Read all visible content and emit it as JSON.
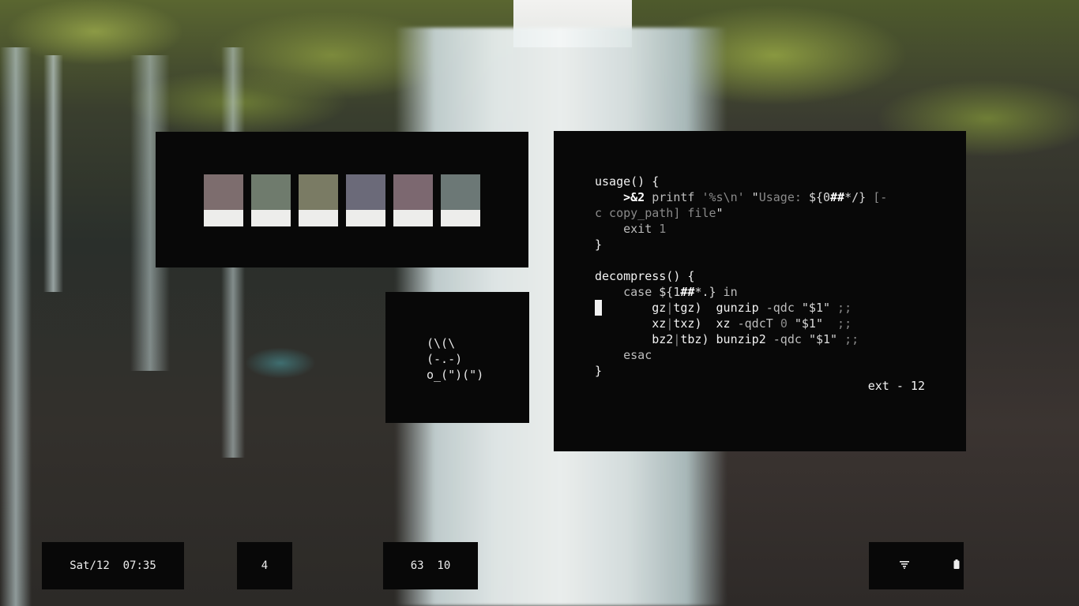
{
  "palette": {
    "swatches": [
      {
        "top": "#7d6d6e",
        "bottom": "#ededeb"
      },
      {
        "top": "#6f7b6d",
        "bottom": "#ededeb"
      },
      {
        "top": "#7a7b64",
        "bottom": "#ededeb"
      },
      {
        "top": "#6b6a79",
        "bottom": "#ededeb"
      },
      {
        "top": "#7c6870",
        "bottom": "#ededeb"
      },
      {
        "top": "#6c7876",
        "bottom": "#ededeb"
      }
    ]
  },
  "ascii_art": [
    "(\\(\\",
    "(-.-)",
    "o_(\")(\")"
  ],
  "editor": {
    "lines": [
      [
        {
          "t": "usage() {",
          "c": "kw-fn"
        }
      ],
      [
        {
          "t": "    ",
          "c": ""
        },
        {
          "t": ">&2",
          "c": "kw-bold"
        },
        {
          "t": " printf ",
          "c": ""
        },
        {
          "t": "'%s\\n'",
          "c": "dim"
        },
        {
          "t": " \"",
          "c": "str"
        },
        {
          "t": "Usage: ",
          "c": "dim"
        },
        {
          "t": "${0",
          "c": "str"
        },
        {
          "t": "##",
          "c": "kw-bold"
        },
        {
          "t": "*/}",
          "c": "str"
        },
        {
          "t": " [-",
          "c": "dim"
        }
      ],
      [
        {
          "t": "c copy_path] file",
          "c": "dim"
        },
        {
          "t": "\"",
          "c": "str"
        }
      ],
      [
        {
          "t": "    exit ",
          "c": ""
        },
        {
          "t": "1",
          "c": "dim"
        }
      ],
      [
        {
          "t": "}",
          "c": "kw-fn"
        }
      ],
      [
        {
          "t": "",
          "c": ""
        }
      ],
      [
        {
          "t": "decompress() {",
          "c": "kw-fn"
        }
      ],
      [
        {
          "t": "    case ",
          "c": ""
        },
        {
          "t": "${1",
          "c": "str"
        },
        {
          "t": "##",
          "c": "kw-bold"
        },
        {
          "t": "*.}",
          "c": "str"
        },
        {
          "t": " in",
          "c": ""
        }
      ],
      [
        {
          "t": "        gz",
          "c": "kw-fn"
        },
        {
          "t": "|",
          "c": "dim"
        },
        {
          "t": "tgz",
          "c": "kw-fn"
        },
        {
          "t": ")  gunzip ",
          "c": "kw-fn"
        },
        {
          "t": "-qdc ",
          "c": ""
        },
        {
          "t": "\"$1\"",
          "c": "str"
        },
        {
          "t": " ;;",
          "c": "dim"
        }
      ],
      [
        {
          "t": "        xz",
          "c": "kw-fn"
        },
        {
          "t": "|",
          "c": "dim"
        },
        {
          "t": "txz",
          "c": "kw-fn"
        },
        {
          "t": ")  xz ",
          "c": "kw-fn"
        },
        {
          "t": "-qdcT ",
          "c": ""
        },
        {
          "t": "0 ",
          "c": "dim"
        },
        {
          "t": "\"$1\"",
          "c": "str"
        },
        {
          "t": "  ;;",
          "c": "dim"
        }
      ],
      [
        {
          "t": "        bz2",
          "c": "kw-fn"
        },
        {
          "t": "|",
          "c": "dim"
        },
        {
          "t": "tbz",
          "c": "kw-fn"
        },
        {
          "t": ") bunzip2 ",
          "c": "kw-fn"
        },
        {
          "t": "-qdc ",
          "c": ""
        },
        {
          "t": "\"$1\"",
          "c": "str"
        },
        {
          "t": " ;;",
          "c": "dim"
        }
      ],
      [
        {
          "t": "    esac",
          "c": ""
        }
      ],
      [
        {
          "t": "}",
          "c": "kw-fn"
        }
      ]
    ],
    "status": "ext - 12"
  },
  "bar": {
    "clock": "Sat/12  07:35",
    "workspace": "4",
    "stats": "63  10",
    "tray_icons": [
      "wifi-icon",
      "battery-icon"
    ]
  }
}
